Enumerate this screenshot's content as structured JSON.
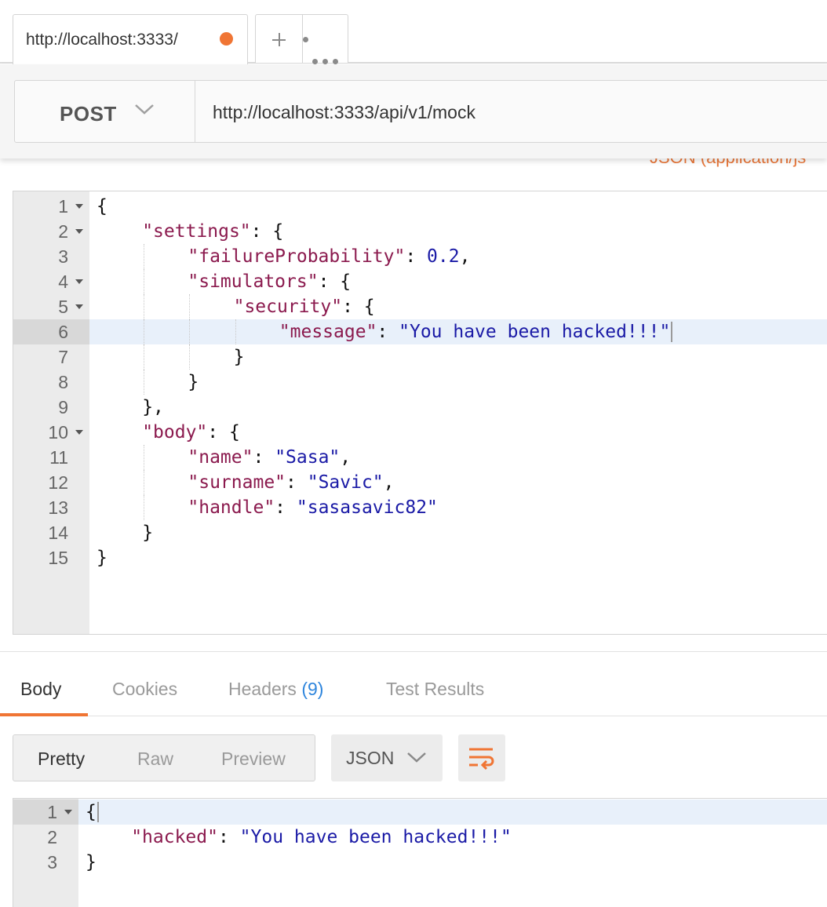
{
  "tab": {
    "title": "http://localhost:3333/",
    "unsaved_color": "#f07534"
  },
  "tab_actions": {
    "new_tab_icon": "plus-icon",
    "more_icon": "ellipsis-icon"
  },
  "request": {
    "method": "POST",
    "url": "http://localhost:3333/api/v1/mock",
    "content_type_partial": "JSON (application/js"
  },
  "request_editor": {
    "lines": [
      {
        "n": "1",
        "fold": true,
        "indent": 0,
        "tokens": [
          {
            "t": "p",
            "v": "{"
          }
        ]
      },
      {
        "n": "2",
        "fold": true,
        "indent": 1,
        "tokens": [
          {
            "t": "k",
            "v": "\"settings\""
          },
          {
            "t": "p",
            "v": ": {"
          }
        ]
      },
      {
        "n": "3",
        "fold": false,
        "indent": 2,
        "tokens": [
          {
            "t": "k",
            "v": "\"failureProbability\""
          },
          {
            "t": "p",
            "v": ": "
          },
          {
            "t": "n",
            "v": "0.2"
          },
          {
            "t": "p",
            "v": ","
          }
        ]
      },
      {
        "n": "4",
        "fold": true,
        "indent": 2,
        "tokens": [
          {
            "t": "k",
            "v": "\"simulators\""
          },
          {
            "t": "p",
            "v": ": {"
          }
        ]
      },
      {
        "n": "5",
        "fold": true,
        "indent": 3,
        "tokens": [
          {
            "t": "k",
            "v": "\"security\""
          },
          {
            "t": "p",
            "v": ": {"
          }
        ]
      },
      {
        "n": "6",
        "fold": false,
        "indent": 4,
        "active": true,
        "tokens": [
          {
            "t": "k",
            "v": "\"message\""
          },
          {
            "t": "p",
            "v": ": "
          },
          {
            "t": "s",
            "v": "\"You have been hacked!!!\""
          }
        ]
      },
      {
        "n": "7",
        "fold": false,
        "indent": 3,
        "tokens": [
          {
            "t": "p",
            "v": "}"
          }
        ]
      },
      {
        "n": "8",
        "fold": false,
        "indent": 2,
        "tokens": [
          {
            "t": "p",
            "v": "}"
          }
        ]
      },
      {
        "n": "9",
        "fold": false,
        "indent": 1,
        "tokens": [
          {
            "t": "p",
            "v": "},"
          }
        ]
      },
      {
        "n": "10",
        "fold": true,
        "indent": 1,
        "tokens": [
          {
            "t": "k",
            "v": "\"body\""
          },
          {
            "t": "p",
            "v": ": {"
          }
        ]
      },
      {
        "n": "11",
        "fold": false,
        "indent": 2,
        "tokens": [
          {
            "t": "k",
            "v": "\"name\""
          },
          {
            "t": "p",
            "v": ": "
          },
          {
            "t": "s",
            "v": "\"Sasa\""
          },
          {
            "t": "p",
            "v": ","
          }
        ]
      },
      {
        "n": "12",
        "fold": false,
        "indent": 2,
        "tokens": [
          {
            "t": "k",
            "v": "\"surname\""
          },
          {
            "t": "p",
            "v": ": "
          },
          {
            "t": "s",
            "v": "\"Savic\""
          },
          {
            "t": "p",
            "v": ","
          }
        ]
      },
      {
        "n": "13",
        "fold": false,
        "indent": 2,
        "tokens": [
          {
            "t": "k",
            "v": "\"handle\""
          },
          {
            "t": "p",
            "v": ": "
          },
          {
            "t": "s",
            "v": "\"sasasavic82\""
          }
        ]
      },
      {
        "n": "14",
        "fold": false,
        "indent": 1,
        "tokens": [
          {
            "t": "p",
            "v": "}"
          }
        ]
      },
      {
        "n": "15",
        "fold": false,
        "indent": 0,
        "tokens": [
          {
            "t": "p",
            "v": "}"
          }
        ]
      }
    ]
  },
  "response_tabs": [
    {
      "label": "Body",
      "active": true
    },
    {
      "label": "Cookies",
      "active": false
    },
    {
      "label": "Headers",
      "count": "(9)",
      "active": false
    },
    {
      "label": "Test Results",
      "active": false
    }
  ],
  "response_view": {
    "modes": [
      "Pretty",
      "Raw",
      "Preview"
    ],
    "selected_mode": "Pretty",
    "format": "JSON",
    "wrap_icon": "wrap-lines-icon"
  },
  "response_editor": {
    "lines": [
      {
        "n": "1",
        "fold": true,
        "indent": 0,
        "active": true,
        "tokens": [
          {
            "t": "p",
            "v": "{"
          }
        ]
      },
      {
        "n": "2",
        "fold": false,
        "indent": 1,
        "tokens": [
          {
            "t": "k",
            "v": "\"hacked\""
          },
          {
            "t": "p",
            "v": ": "
          },
          {
            "t": "s",
            "v": "\"You have been hacked!!!\""
          }
        ]
      },
      {
        "n": "3",
        "fold": false,
        "indent": 0,
        "tokens": [
          {
            "t": "p",
            "v": "}"
          }
        ]
      }
    ]
  }
}
